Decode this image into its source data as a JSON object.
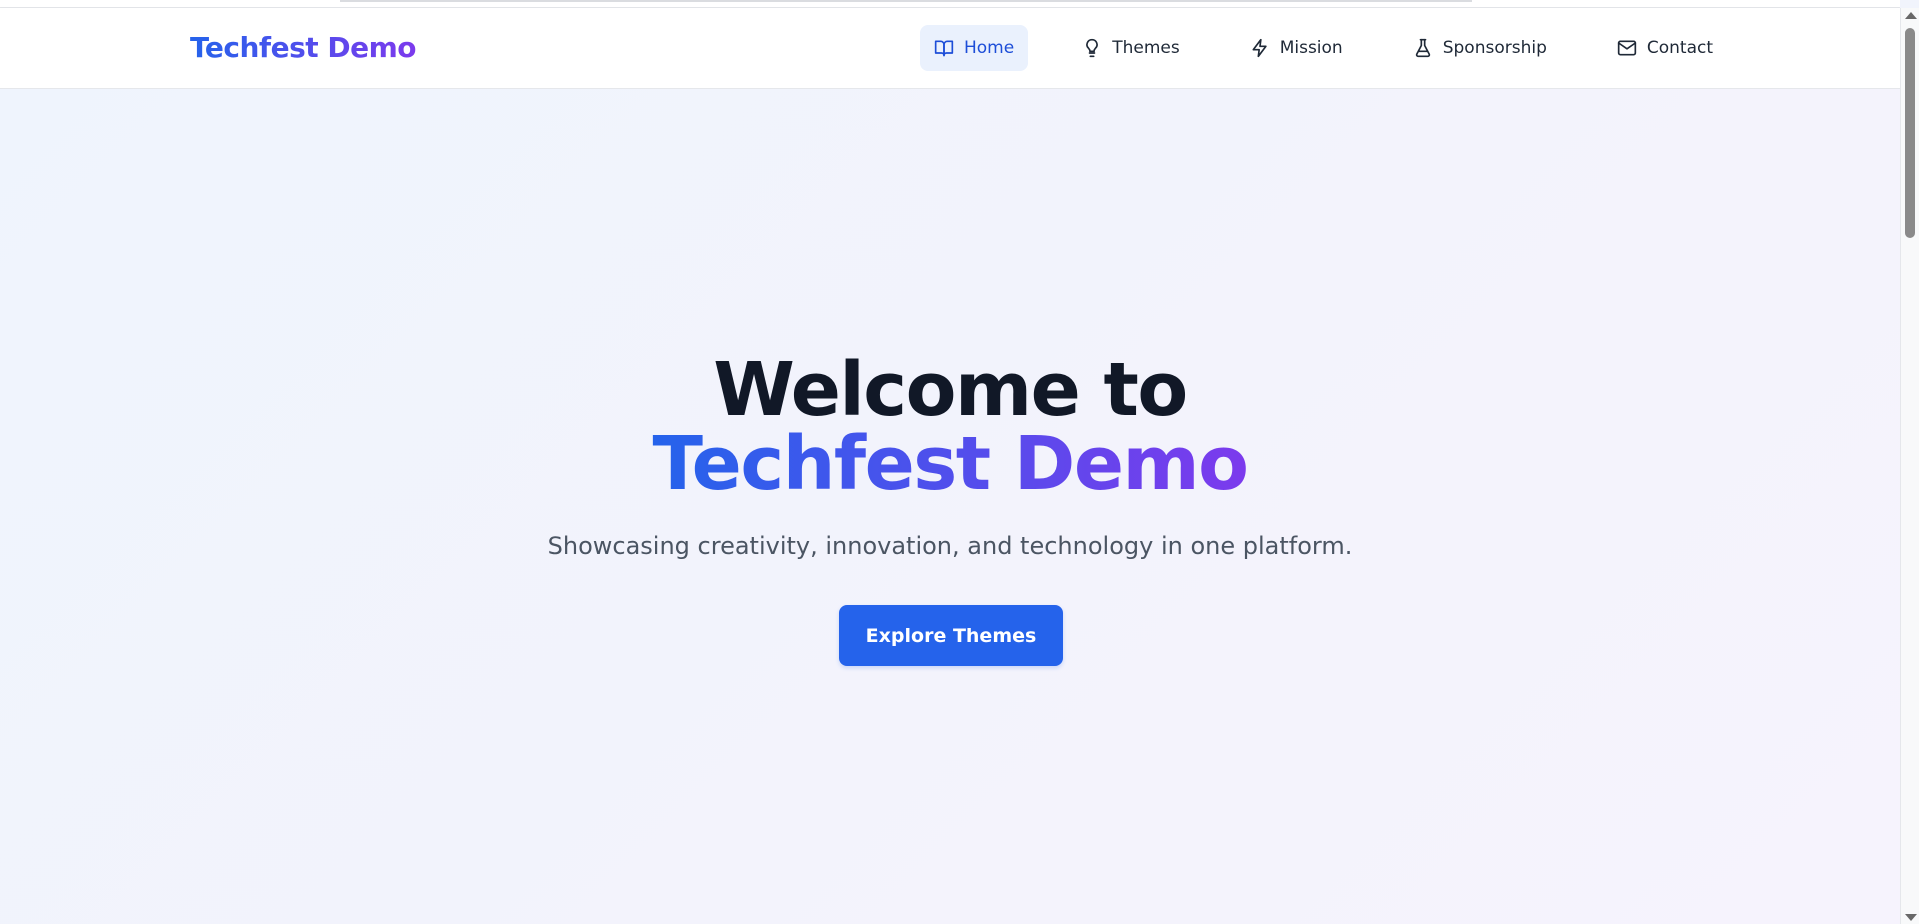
{
  "brand": {
    "name": "Techfest Demo",
    "gradient_start": "#2563eb",
    "gradient_end": "#7c3aed"
  },
  "nav": {
    "items": [
      {
        "label": "Home",
        "icon": "book-open-icon",
        "active": true
      },
      {
        "label": "Themes",
        "icon": "lightbulb-icon",
        "active": false
      },
      {
        "label": "Mission",
        "icon": "lightning-bolt-icon",
        "active": false
      },
      {
        "label": "Sponsorship",
        "icon": "flask-icon",
        "active": false
      },
      {
        "label": "Contact",
        "icon": "mail-icon",
        "active": false
      }
    ],
    "active_color": "#1d4ed8",
    "active_background": "#eaf1fd"
  },
  "hero": {
    "title_line1": "Welcome to",
    "title_line2": "Techfest Demo",
    "subtitle": "Showcasing creativity, innovation, and technology in one platform.",
    "cta_label": "Explore Themes",
    "cta_color": "#2563eb"
  }
}
